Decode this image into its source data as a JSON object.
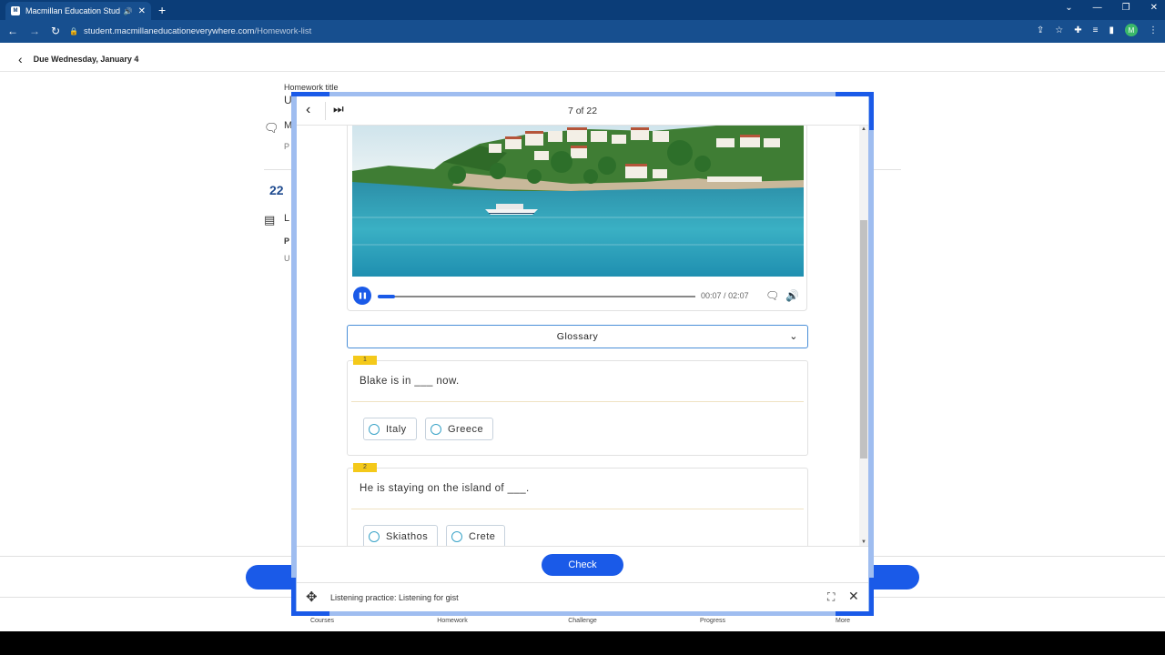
{
  "browser": {
    "tab_title": "Macmillan Education Studen",
    "tab_favicon": "M",
    "url_host": "student.macmillaneducationeverywhere.com",
    "url_path": "/Homework-list",
    "profile_initial": "M"
  },
  "page": {
    "due_label": "Due Wednesday, January 4",
    "homework_title_label": "Homework title",
    "bg_title_initial": "U",
    "bg_item_initial": "M",
    "bg_item_sub_initial": "P",
    "bg_count": "22",
    "bg_lesson_initial": "L",
    "bg_lesson_sub_initial": "P",
    "bg_lesson_sub2_initial": "U",
    "bottom_nav": [
      "Courses",
      "Homework",
      "Challenge",
      "Progress",
      "More"
    ]
  },
  "modal": {
    "counter": "7 of 22",
    "video": {
      "current_time": "00:07",
      "separator": "/",
      "duration": "02:07",
      "progress": 0.055
    },
    "glossary_label": "Glossary",
    "questions": [
      {
        "number": "1",
        "text": "Blake is in ___ now.",
        "options": [
          "Italy",
          "Greece"
        ]
      },
      {
        "number": "2",
        "text": "He is staying on the island of ___.",
        "options": [
          "Skiathos",
          "Crete"
        ]
      }
    ],
    "check_label": "Check",
    "activity_title": "Listening practice: Listening for gist"
  },
  "colors": {
    "accent": "#1a5ae8",
    "tag": "#f4c91a",
    "chrome": "#0b3d78"
  }
}
